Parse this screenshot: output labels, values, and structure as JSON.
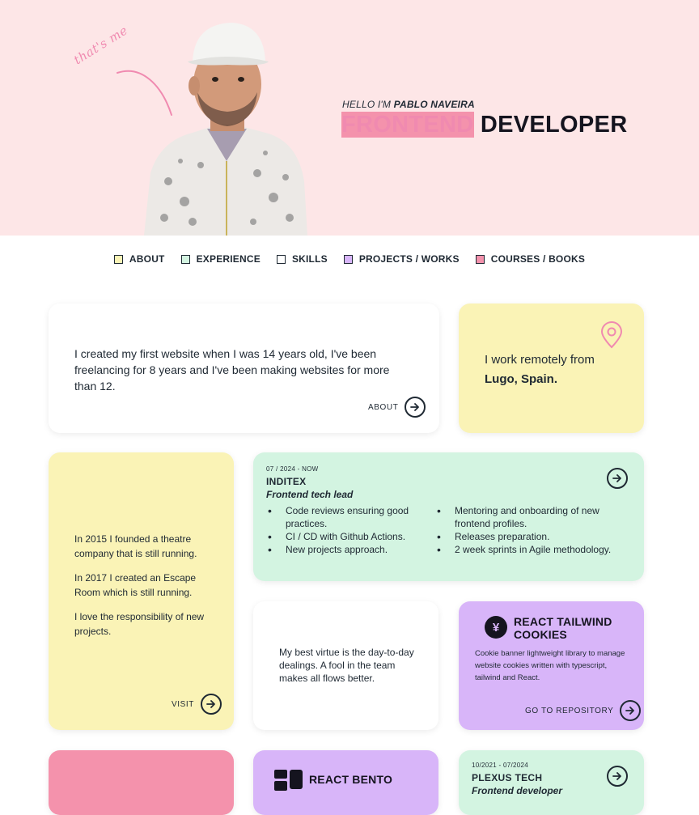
{
  "hero": {
    "handwritten": "that's me",
    "hello_prefix": "HELLO I'M",
    "name": "PABLO NAVEIRA",
    "headline_pink": "FRONTEND",
    "headline_dark": "DEVELOPER"
  },
  "nav": [
    {
      "label": "ABOUT",
      "color": "#faf3b6"
    },
    {
      "label": "EXPERIENCE",
      "color": "#d3f4e1"
    },
    {
      "label": "SKILLS",
      "color": "#ffffff"
    },
    {
      "label": "PROJECTS / WORKS",
      "color": "#d8b5f9"
    },
    {
      "label": "COURSES / BOOKS",
      "color": "#f492ac"
    }
  ],
  "about_card": {
    "text": "I created my first website when I was 14 years old, I've been freelancing for 8 years and I've been making websites for more than 12.",
    "link": "ABOUT"
  },
  "location_card": {
    "text_prefix": "I work remotely from",
    "location": "Lugo, Spain."
  },
  "projects_card": {
    "p1": "In 2015 I founded a theatre company that is still running.",
    "p2": "In 2017 I created an Escape Room which is still running.",
    "p3": "I love the responsibility of new projects.",
    "link": "VISIT"
  },
  "job1": {
    "date": "07 / 2024 - NOW",
    "company": "INDITEX",
    "role": "Frontend tech lead",
    "bullets_left": [
      "Code reviews ensuring good practices.",
      "CI / CD with Github Actions.",
      "New projects approach."
    ],
    "bullets_right": [
      "Mentoring and onboarding of new frontend profiles.",
      "Releases preparation.",
      "2 week sprints in Agile methodology."
    ]
  },
  "virtue_card": {
    "text": "My best virtue is the day-to-day dealings. A fool in the team makes all flows better."
  },
  "cookies_card": {
    "logo_glyph": "¥",
    "title": "REACT TAILWIND COOKIES",
    "desc": "Cookie banner lightweight library to manage website cookies written with typescript, tailwind and React.",
    "link": "GO TO REPOSITORY"
  },
  "bento_card": {
    "title": "REACT BENTO"
  },
  "job2": {
    "date": "10/2021 - 07/2024",
    "company": "PLEXUS TECH",
    "role": "Frontend developer"
  },
  "colors": {
    "hero_bg": "#fde6e7",
    "accent_pink": "#f08ab0",
    "yellow": "#faf3b6",
    "green": "#d3f4e1",
    "purple": "#d8b5f9",
    "pink": "#f492ac"
  }
}
